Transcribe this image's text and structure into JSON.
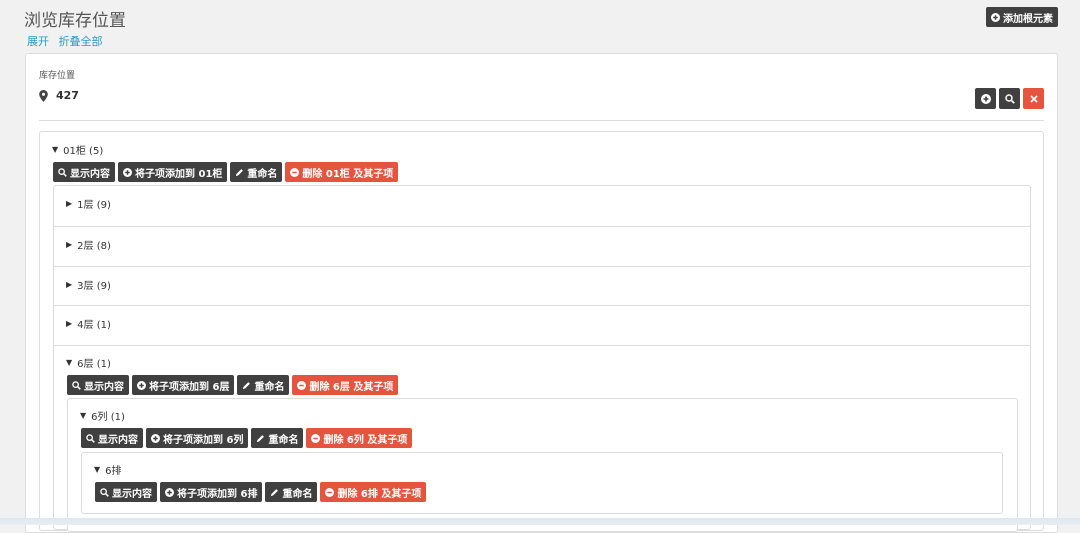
{
  "header": {
    "title": "浏览库存位置",
    "expand": "展开",
    "collapse_all": "折叠全部",
    "add_root": "添加根元素"
  },
  "location": {
    "label": "库存位置",
    "value": "427"
  },
  "node01": {
    "title": "01柜 (5)",
    "show": "显示内容",
    "add_child": "将子项添加到 01柜",
    "rename": "重命名",
    "delete": "删除 01柜 及其子项"
  },
  "floors": [
    {
      "title": "1层 (9)"
    },
    {
      "title": "2层 (8)"
    },
    {
      "title": "3层 (9)"
    },
    {
      "title": "4层 (1)"
    }
  ],
  "floor6": {
    "title": "6层 (1)",
    "show": "显示内容",
    "add_child": "将子项添加到 6层",
    "rename": "重命名",
    "delete": "删除 6层 及其子项"
  },
  "col6": {
    "title": "6列 (1)",
    "show": "显示内容",
    "add_child": "将子项添加到 6列",
    "rename": "重命名",
    "delete": "删除 6列 及其子项"
  },
  "row6": {
    "title": "6排",
    "show": "显示内容",
    "add_child": "将子项添加到 6排",
    "rename": "重命名",
    "delete": "删除 6排 及其子项"
  },
  "colors": {
    "dark_button": "#404040",
    "danger": "#e5543e",
    "link": "#2a9ac8"
  }
}
